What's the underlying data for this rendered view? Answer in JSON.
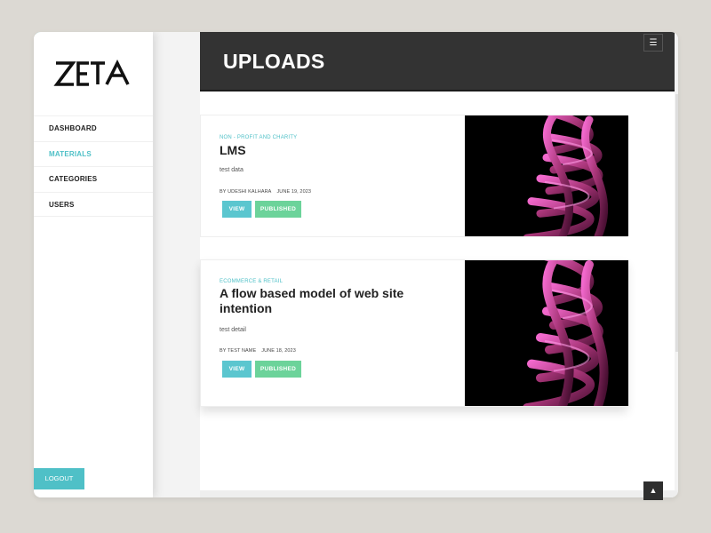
{
  "brand": {
    "logo_text": "ZETA"
  },
  "sidebar": {
    "items": [
      {
        "label": "DASHBOARD",
        "active": false
      },
      {
        "label": "MATERIALS",
        "active": true
      },
      {
        "label": "CATEGORIES",
        "active": false
      },
      {
        "label": "USERS",
        "active": false
      }
    ],
    "logout_label": "LOGOUT"
  },
  "header": {
    "title": "UPLOADS",
    "menu_icon": "hamburger-icon"
  },
  "cards": [
    {
      "category": "NON - PROFIT AND CHARITY",
      "title": "LMS",
      "description": "test data",
      "author": "BY UDESHI KALHARA",
      "date": "JUNE 19, 2023",
      "view_label": "VIEW",
      "status_label": "PUBLISHED"
    },
    {
      "category": "ECOMMERCE & RETAIL",
      "title": "A flow based model of web site intention",
      "description": "test detail",
      "author": "BY TEST NAME",
      "date": "JUNE 18, 2023",
      "view_label": "VIEW",
      "status_label": "PUBLISHED"
    }
  ],
  "scroll_top_icon": "chevron-up-icon",
  "colors": {
    "accent": "#4fc0c7",
    "published": "#6cd39a",
    "header_bg": "#333333",
    "page_bg": "#dcd9d3"
  }
}
